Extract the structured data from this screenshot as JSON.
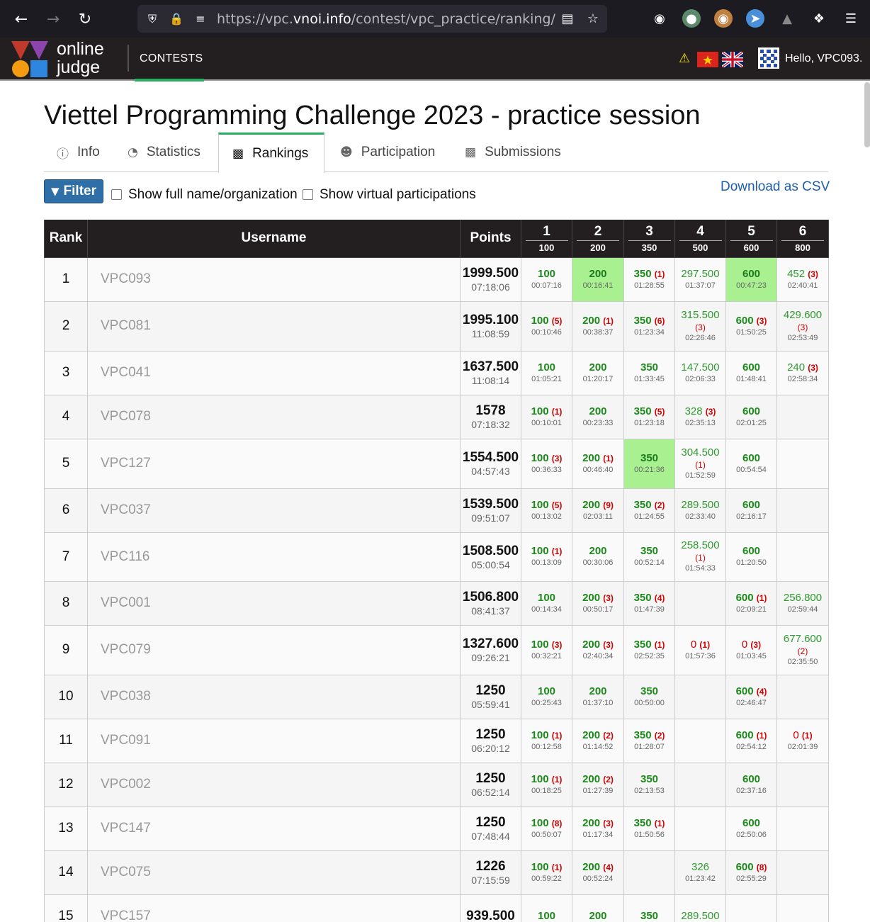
{
  "browser": {
    "url_prefix": "https://vpc.",
    "url_host": "vnoi.info",
    "url_path": "/contest/vpc_practice/ranking/"
  },
  "header": {
    "logo_line1": "online",
    "logo_line2": "judge",
    "nav_contests": "CONTESTS",
    "hello": "Hello, VPC093."
  },
  "page": {
    "title": "Viettel Programming Challenge 2023 - practice session",
    "tabs": [
      {
        "label": "Info"
      },
      {
        "label": "Statistics"
      },
      {
        "label": "Rankings"
      },
      {
        "label": "Participation"
      },
      {
        "label": "Submissions"
      }
    ],
    "filter_label": "Filter",
    "show_full_name": "Show full name/organization",
    "show_virtual": "Show virtual participations",
    "download_csv": "Download as CSV"
  },
  "table": {
    "headers": {
      "rank": "Rank",
      "username": "Username",
      "points": "Points"
    },
    "problems": [
      {
        "num": "1",
        "pts": "100"
      },
      {
        "num": "2",
        "pts": "200"
      },
      {
        "num": "3",
        "pts": "350"
      },
      {
        "num": "4",
        "pts": "500"
      },
      {
        "num": "5",
        "pts": "600"
      },
      {
        "num": "6",
        "pts": "800"
      }
    ],
    "rows": [
      {
        "rank": "1",
        "user": "VPC093",
        "points": "1999.500",
        "time": "07:18:06",
        "h": 62,
        "cells": [
          {
            "v": "100",
            "k": "full",
            "t": "00:07:16"
          },
          {
            "v": "200",
            "k": "full",
            "t": "00:16:41",
            "first": true
          },
          {
            "v": "350",
            "k": "full",
            "p": "(1)",
            "t": "01:28:55"
          },
          {
            "v": "297.500",
            "k": "part",
            "t": "01:37:07"
          },
          {
            "v": "600",
            "k": "full",
            "t": "00:47:23",
            "first": true
          },
          {
            "v": "452",
            "k": "part",
            "p": "(3)",
            "t": "02:40:41"
          }
        ]
      },
      {
        "rank": "2",
        "user": "VPC081",
        "points": "1995.100",
        "time": "11:08:59",
        "h": 70,
        "cells": [
          {
            "v": "100",
            "k": "full",
            "p": "(5)",
            "t": "00:10:46"
          },
          {
            "v": "200",
            "k": "full",
            "p": "(1)",
            "t": "00:38:37"
          },
          {
            "v": "350",
            "k": "full",
            "p": "(6)",
            "t": "01:23:34"
          },
          {
            "v": "315.500",
            "k": "part",
            "p2": "(3)",
            "t": "02:26:46"
          },
          {
            "v": "600",
            "k": "full",
            "p": "(3)",
            "t": "01:50:25"
          },
          {
            "v": "429.600",
            "k": "part",
            "p2": "(3)",
            "t": "02:53:49"
          }
        ]
      },
      {
        "rank": "3",
        "user": "VPC041",
        "points": "1637.500",
        "time": "11:08:14",
        "h": 62,
        "cells": [
          {
            "v": "100",
            "k": "full",
            "t": "01:05:21"
          },
          {
            "v": "200",
            "k": "full",
            "t": "01:20:17"
          },
          {
            "v": "350",
            "k": "full",
            "t": "01:33:45"
          },
          {
            "v": "147.500",
            "k": "part",
            "t": "02:06:33"
          },
          {
            "v": "600",
            "k": "full",
            "t": "01:48:41"
          },
          {
            "v": "240",
            "k": "part",
            "p": "(3)",
            "t": "02:58:34"
          }
        ]
      },
      {
        "rank": "4",
        "user": "VPC078",
        "points": "1578",
        "time": "07:18:32",
        "h": 62,
        "cells": [
          {
            "v": "100",
            "k": "full",
            "p": "(1)",
            "t": "00:10:01"
          },
          {
            "v": "200",
            "k": "full",
            "t": "00:23:33"
          },
          {
            "v": "350",
            "k": "full",
            "p": "(5)",
            "t": "01:23:18"
          },
          {
            "v": "328",
            "k": "part",
            "p": "(3)",
            "t": "02:35:13"
          },
          {
            "v": "600",
            "k": "full",
            "t": "02:01:25"
          },
          {}
        ]
      },
      {
        "rank": "5",
        "user": "VPC127",
        "points": "1554.500",
        "time": "04:57:43",
        "h": 70,
        "cells": [
          {
            "v": "100",
            "k": "full",
            "p": "(3)",
            "t": "00:36:33"
          },
          {
            "v": "200",
            "k": "full",
            "p": "(1)",
            "t": "00:46:40"
          },
          {
            "v": "350",
            "k": "full",
            "t": "00:21:36",
            "first": true
          },
          {
            "v": "304.500",
            "k": "part",
            "p2": "(1)",
            "t": "01:52:59"
          },
          {
            "v": "600",
            "k": "full",
            "t": "00:54:54"
          },
          {}
        ]
      },
      {
        "rank": "6",
        "user": "VPC037",
        "points": "1539.500",
        "time": "09:51:07",
        "h": 62,
        "cells": [
          {
            "v": "100",
            "k": "full",
            "p": "(5)",
            "t": "00:13:02"
          },
          {
            "v": "200",
            "k": "full",
            "p": "(9)",
            "t": "02:03:11"
          },
          {
            "v": "350",
            "k": "full",
            "p": "(2)",
            "t": "01:24:55"
          },
          {
            "v": "289.500",
            "k": "part",
            "t": "02:33:40"
          },
          {
            "v": "600",
            "k": "full",
            "t": "02:16:17"
          },
          {}
        ]
      },
      {
        "rank": "7",
        "user": "VPC116",
        "points": "1508.500",
        "time": "05:00:54",
        "h": 69,
        "cells": [
          {
            "v": "100",
            "k": "full",
            "p": "(1)",
            "t": "00:13:09"
          },
          {
            "v": "200",
            "k": "full",
            "t": "00:30:06"
          },
          {
            "v": "350",
            "k": "full",
            "t": "00:52:14"
          },
          {
            "v": "258.500",
            "k": "part",
            "p2": "(1)",
            "t": "01:54:33"
          },
          {
            "v": "600",
            "k": "full",
            "t": "01:20:50"
          },
          {}
        ]
      },
      {
        "rank": "8",
        "user": "VPC001",
        "points": "1506.800",
        "time": "08:41:37",
        "h": 62,
        "cells": [
          {
            "v": "100",
            "k": "full",
            "t": "00:14:34"
          },
          {
            "v": "200",
            "k": "full",
            "p": "(3)",
            "t": "00:50:17"
          },
          {
            "v": "350",
            "k": "full",
            "p": "(4)",
            "t": "01:47:39"
          },
          {},
          {
            "v": "600",
            "k": "full",
            "p": "(1)",
            "t": "02:09:21"
          },
          {
            "v": "256.800",
            "k": "part",
            "t": "02:59:44"
          }
        ]
      },
      {
        "rank": "9",
        "user": "VPC079",
        "points": "1327.600",
        "time": "09:26:21",
        "h": 70,
        "cells": [
          {
            "v": "100",
            "k": "full",
            "p": "(3)",
            "t": "00:32:21"
          },
          {
            "v": "200",
            "k": "full",
            "p": "(3)",
            "t": "02:40:34"
          },
          {
            "v": "350",
            "k": "full",
            "p": "(1)",
            "t": "02:52:35"
          },
          {
            "v": "0",
            "k": "zero",
            "p": "(1)",
            "t": "01:57:36"
          },
          {
            "v": "0",
            "k": "zero",
            "p": "(3)",
            "t": "01:03:45"
          },
          {
            "v": "677.600",
            "k": "part",
            "p2": "(2)",
            "t": "02:35:50"
          }
        ]
      },
      {
        "rank": "10",
        "user": "VPC038",
        "points": "1250",
        "time": "05:59:41",
        "h": 62,
        "cells": [
          {
            "v": "100",
            "k": "full",
            "t": "00:25:43"
          },
          {
            "v": "200",
            "k": "full",
            "t": "01:37:10"
          },
          {
            "v": "350",
            "k": "full",
            "t": "00:50:00"
          },
          {},
          {
            "v": "600",
            "k": "full",
            "p": "(4)",
            "t": "02:46:47"
          },
          {}
        ]
      },
      {
        "rank": "11",
        "user": "VPC091",
        "points": "1250",
        "time": "06:20:12",
        "h": 62,
        "cells": [
          {
            "v": "100",
            "k": "full",
            "p": "(1)",
            "t": "00:12:58"
          },
          {
            "v": "200",
            "k": "full",
            "p": "(2)",
            "t": "01:14:52"
          },
          {
            "v": "350",
            "k": "full",
            "p": "(2)",
            "t": "01:28:07"
          },
          {},
          {
            "v": "600",
            "k": "full",
            "p": "(1)",
            "t": "02:54:12"
          },
          {
            "v": "0",
            "k": "zero",
            "p": "(1)",
            "t": "02:01:39"
          }
        ]
      },
      {
        "rank": "12",
        "user": "VPC002",
        "points": "1250",
        "time": "06:52:14",
        "h": 62,
        "cells": [
          {
            "v": "100",
            "k": "full",
            "p": "(1)",
            "t": "00:18:25"
          },
          {
            "v": "200",
            "k": "full",
            "p": "(2)",
            "t": "01:27:39"
          },
          {
            "v": "350",
            "k": "full",
            "t": "02:13:53"
          },
          {},
          {
            "v": "600",
            "k": "full",
            "t": "02:37:16"
          },
          {}
        ]
      },
      {
        "rank": "13",
        "user": "VPC147",
        "points": "1250",
        "time": "07:48:44",
        "h": 62,
        "cells": [
          {
            "v": "100",
            "k": "full",
            "p": "(8)",
            "t": "00:50:07"
          },
          {
            "v": "200",
            "k": "full",
            "p": "(3)",
            "t": "01:17:34"
          },
          {
            "v": "350",
            "k": "full",
            "p": "(1)",
            "t": "01:50:56"
          },
          {},
          {
            "v": "600",
            "k": "full",
            "t": "02:50:06"
          },
          {}
        ]
      },
      {
        "rank": "14",
        "user": "VPC075",
        "points": "1226",
        "time": "07:15:59",
        "h": 62,
        "cells": [
          {
            "v": "100",
            "k": "full",
            "p": "(1)",
            "t": "00:59:22"
          },
          {
            "v": "200",
            "k": "full",
            "p": "(4)",
            "t": "00:52:24"
          },
          {},
          {
            "v": "326",
            "k": "part",
            "t": "01:23:42"
          },
          {
            "v": "600",
            "k": "full",
            "p": "(8)",
            "t": "02:55:29"
          },
          {}
        ]
      },
      {
        "rank": "15",
        "user": "VPC157",
        "points": "939.500",
        "time": "",
        "h": 62,
        "cells": [
          {
            "v": "100",
            "k": "full",
            "t": ""
          },
          {
            "v": "200",
            "k": "full",
            "t": ""
          },
          {
            "v": "350",
            "k": "full",
            "t": ""
          },
          {
            "v": "289.500",
            "k": "part",
            "t": ""
          },
          {},
          {}
        ]
      }
    ]
  },
  "colors": {
    "accent_green": "#27ae60",
    "first_solve": "#a8f090",
    "filter_button": "#2e6fa8",
    "link": "#1f5ea8"
  }
}
